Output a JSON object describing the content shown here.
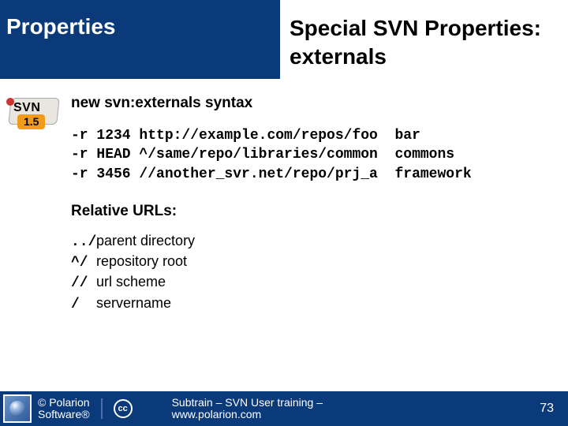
{
  "header": {
    "left": "Properties",
    "right_line1": "Special SVN Properties:",
    "right_line2": "externals"
  },
  "svn_logo": {
    "text": "SVN",
    "version": "1.5"
  },
  "section_title": "new svn:externals syntax",
  "code_lines": [
    "-r 1234 http://example.com/repos/foo  bar",
    "-r HEAD ^/same/repo/libraries/common  commons",
    "-r 3456 //another_svr.net/repo/prj_a  framework"
  ],
  "relative_urls": {
    "title": "Relative URLs:",
    "items": [
      {
        "sym": "../",
        "desc": "parent directory"
      },
      {
        "sym": "^/",
        "desc": "repository root"
      },
      {
        "sym": "//",
        "desc": "url scheme"
      },
      {
        "sym": "/",
        "desc": "servername"
      }
    ]
  },
  "footer": {
    "copyright_line1": "© Polarion",
    "copyright_line2": "Software®",
    "cc": "cc",
    "center_line1": "Subtrain – SVN User training –",
    "center_line2": "www.polarion.com",
    "page": "73"
  }
}
